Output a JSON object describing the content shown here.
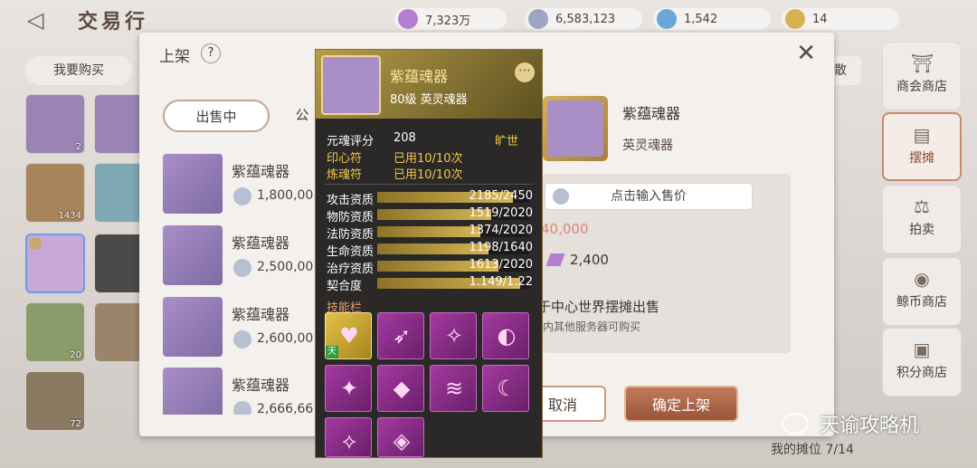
{
  "header": {
    "title": "交易行",
    "currencies": [
      {
        "value": "7,323万",
        "color": "#b57ed2"
      },
      {
        "value": "6,583,123",
        "color": "#9aa6c4"
      },
      {
        "value": "1,542",
        "color": "#6aa7d6"
      },
      {
        "value": "14",
        "color": "#d6b052"
      }
    ]
  },
  "left": {
    "want_label": "我要购买",
    "inventory": [
      {
        "cnt": "2",
        "color": "#b07a86"
      },
      {
        "cnt": "",
        "color": "#4b5a78"
      },
      {
        "cnt": "1434",
        "color": "#c58a3a"
      },
      {
        "cnt": "",
        "color": "#8ab6c6"
      },
      {
        "cnt": "",
        "color": "#a98fc6"
      },
      {
        "cnt": "",
        "color": "#3a3a3a"
      },
      {
        "cnt": "20",
        "color": "#b98a4a"
      },
      {
        "cnt": "",
        "color": "#a87a5a"
      },
      {
        "cnt": "72",
        "color": "#8a7040"
      }
    ]
  },
  "right_nav": [
    {
      "label": "商会商店",
      "icon": "⛩"
    },
    {
      "label": "摆摊",
      "icon": "▤"
    },
    {
      "label": "拍卖",
      "icon": "⚖"
    },
    {
      "label": "鲸币商店",
      "icon": "◉"
    },
    {
      "label": "积分商店",
      "icon": "▣"
    }
  ],
  "right_cut": "散",
  "modal": {
    "title": "上架",
    "help": "?",
    "close": "✕",
    "tabs": {
      "selling": "出售中",
      "other": "公"
    },
    "listings": [
      {
        "name": "紫蕴魂器",
        "price": "1,800,00"
      },
      {
        "name": "紫蕴魂器",
        "price": "2,500,00"
      },
      {
        "name": "紫蕴魂器",
        "price": "2,600,00"
      },
      {
        "name": "紫蕴魂器",
        "price": "2,666,66"
      }
    ],
    "item": {
      "name": "紫蕴魂器",
      "type": "英灵魂器"
    },
    "price_placeholder": "点击输入售价",
    "ref_price": "40,000",
    "fee": "2,400",
    "world_stall": "于中心世界摆摊出售",
    "world_sub": "内其他服务器可购买",
    "cancel": "取消",
    "confirm": "确定上架"
  },
  "tooltip": {
    "name": "紫蕴魂器",
    "level": "80级 英灵魂器",
    "menu": "⋯",
    "score_label": "元魂评分",
    "score": "208",
    "rank": "旷世",
    "seal_label": "印心符",
    "seal": "已用10/10次",
    "refine_label": "炼魂符",
    "refine": "已用10/10次",
    "stats": [
      {
        "name": "攻击资质",
        "text": "2185/2450",
        "fraction": 0.892
      },
      {
        "name": "物防资质",
        "text": "1519/2020",
        "fraction": 0.752
      },
      {
        "name": "法防资质",
        "text": "1374/2020",
        "fraction": 0.68
      },
      {
        "name": "生命资质",
        "text": "1198/1640",
        "fraction": 0.73
      },
      {
        "name": "治疗资质",
        "text": "1613/2020",
        "fraction": 0.799
      },
      {
        "name": "契合度",
        "text": "1.149/1.22",
        "fraction": 0.942
      }
    ],
    "skills_label": "技能栏",
    "skills": [
      {
        "glyph": "♥",
        "mark": "天"
      },
      {
        "glyph": "➶",
        "mark": ""
      },
      {
        "glyph": "✧",
        "mark": ""
      },
      {
        "glyph": "◐",
        "mark": ""
      },
      {
        "glyph": "✦",
        "mark": ""
      },
      {
        "glyph": "◆",
        "mark": ""
      },
      {
        "glyph": "≋",
        "mark": ""
      },
      {
        "glyph": "☾",
        "mark": ""
      },
      {
        "glyph": "⟡",
        "mark": ""
      },
      {
        "glyph": "◈",
        "mark": ""
      }
    ]
  },
  "footer": {
    "stall": "我的摊位 7/14"
  },
  "watermark": "天谕攻略机"
}
